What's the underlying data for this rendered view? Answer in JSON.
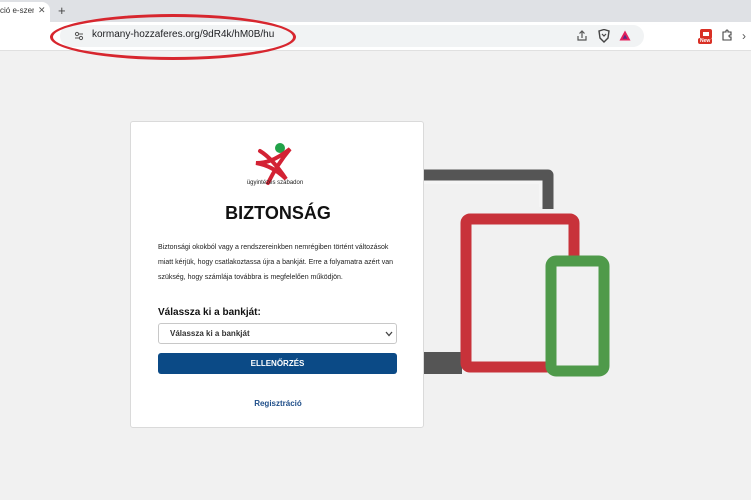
{
  "browser": {
    "tab_title": "ció e-szem",
    "tab_close": "✕",
    "new_tab": "+",
    "url": "kormany-hozzaferes.org/9dR4k/hM0B/hu",
    "extension_badge": "New",
    "overflow": "›",
    "icons": [
      "tune-icon",
      "share-icon",
      "brave-shield-icon",
      "bat-icon",
      "puzzle-icon"
    ]
  },
  "page": {
    "logo_text": "ügyintézés szabadon",
    "title": "BIZTONSÁG",
    "paragraph": "Biztonsági okokból vagy a rendszereinkben nemrégiben történt változások miatt kérjük, hogy csatlakoztassa újra a bankját. Erre a folyamatra azért van szükség, hogy számlája továbbra is megfelelően működjön.",
    "bank_label": "Válassza ki a bankját:",
    "bank_select_value": "Válassza ki a bankját",
    "submit_label": "ELLENŐRZÉS",
    "register_link": "Regisztráció"
  },
  "colors": {
    "annotation_oval": "#d7262e",
    "device_dark": "#555555",
    "device_red": "#c8323a",
    "device_green": "#4f9a4a",
    "button": "#0b4a86",
    "link": "#1f4e89",
    "logo_red": "#d32234",
    "logo_green": "#22a249"
  }
}
